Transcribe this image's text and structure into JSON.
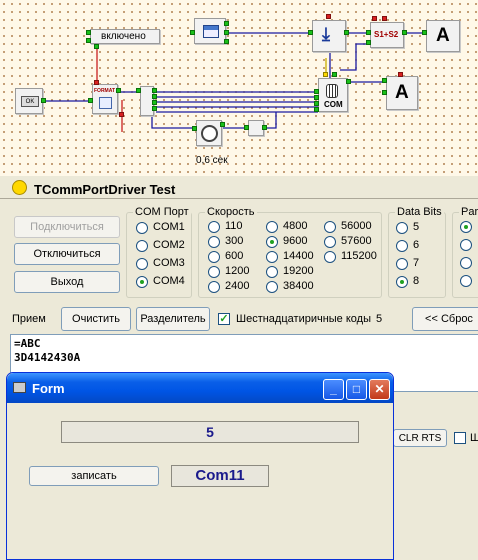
{
  "schema": {
    "label_enabled": "включено",
    "label_delay": "0,6 сек",
    "ok_block": "OK",
    "format_block": "FORMAT",
    "com_block": "COM",
    "concat_block": "S1+S2",
    "text_block_1": "A",
    "text_block_2": "A"
  },
  "main_window": {
    "title": "TCommPortDriver Test",
    "btn_connect": "Подключиться",
    "btn_disconnect": "Отключиться",
    "btn_exit": "Выход",
    "port_group": {
      "caption": "COM Порт",
      "options": [
        "COM1",
        "COM2",
        "COM3",
        "COM4"
      ],
      "selected": "COM4"
    },
    "speed_group": {
      "caption": "Скорость",
      "options": [
        "110",
        "300",
        "600",
        "1200",
        "2400",
        "4800",
        "9600",
        "14400",
        "19200",
        "38400",
        "56000",
        "57600",
        "115200"
      ],
      "selected": "9600"
    },
    "databits_group": {
      "caption": "Data Bits",
      "options": [
        "5",
        "6",
        "7",
        "8"
      ],
      "selected": "8"
    },
    "parity_caption": "Par",
    "receive_label": "Прием",
    "btn_clear": "Очистить",
    "btn_separator": "Разделитель",
    "hex_checkbox_label": "Шестнадцатиричные коды",
    "hex_checked": true,
    "count_value": "5",
    "btn_reset": "<< Сброс",
    "output_lines": [
      "=ABC",
      "3D4142430A"
    ],
    "btn_clr_rts": "CLR RTS",
    "chk_partial": "Ш"
  },
  "form_window": {
    "title": "Form",
    "value_display": "5",
    "btn_write": "записать",
    "port_label": "Com11",
    "value_color": "#1a1a8c"
  },
  "colors": {
    "xp_title": "#0055e5",
    "wire": "#1a1aa0",
    "pin_green": "#19c019",
    "pin_red": "#d82020",
    "canvas_bg": "#fff8e8"
  }
}
